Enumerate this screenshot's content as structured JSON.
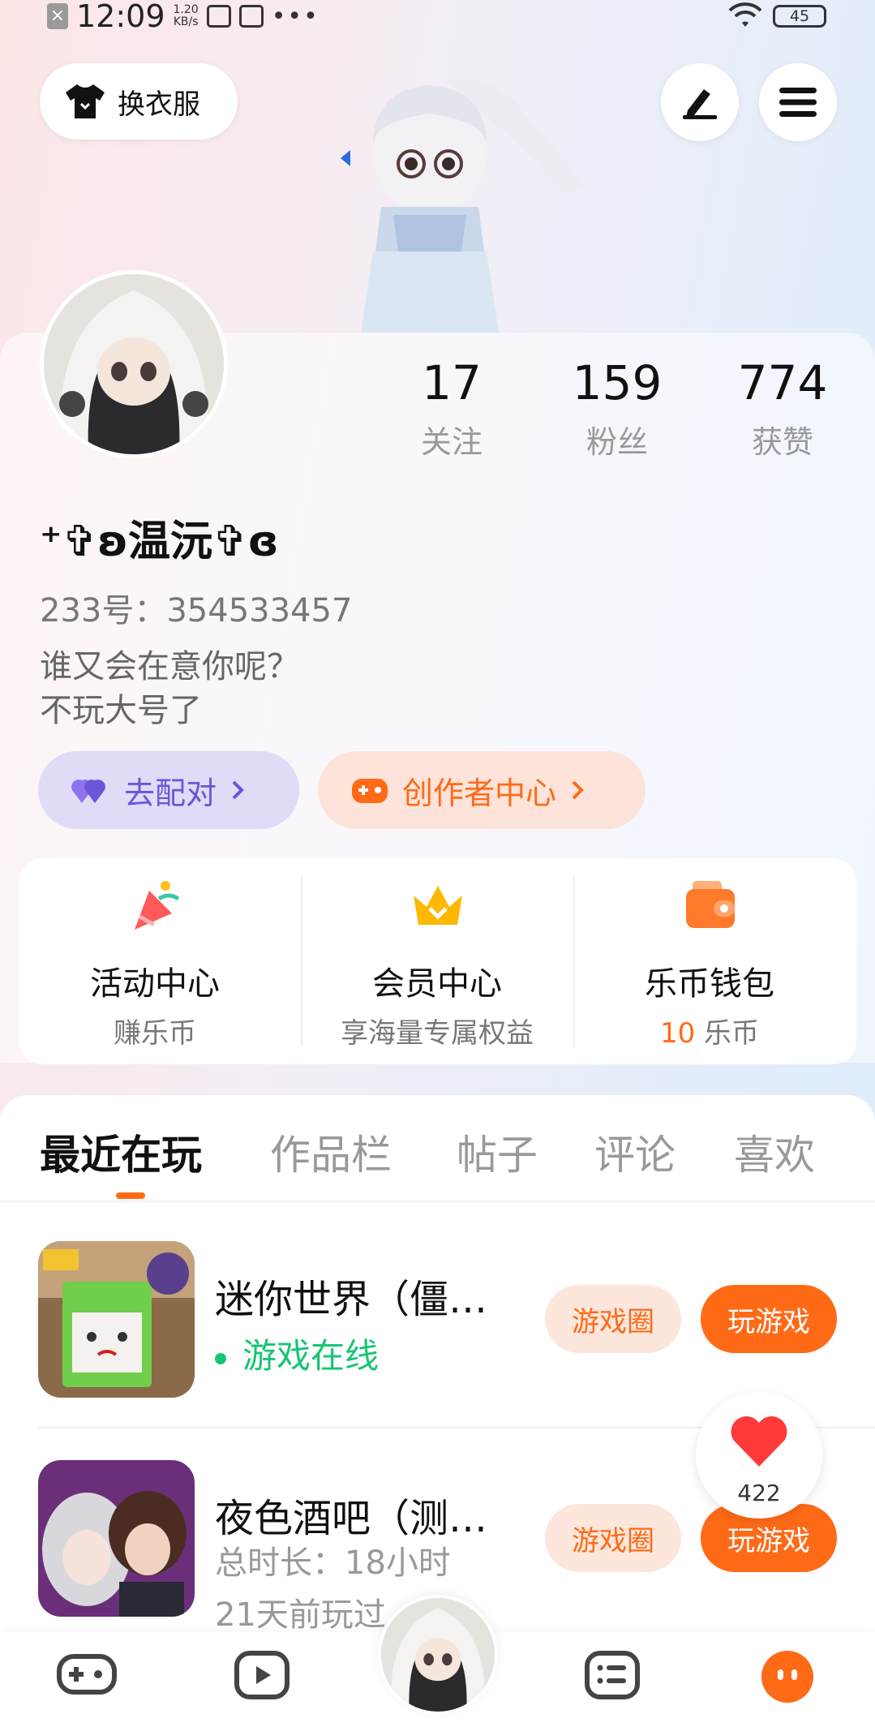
{
  "status_bar": {
    "time": "12:09",
    "speed_value": "1.20",
    "speed_unit": "KB/s",
    "dots": "•••",
    "battery": "45"
  },
  "header": {
    "outfit_label": "换衣服"
  },
  "profile": {
    "stats": [
      {
        "value": "17",
        "label": "关注"
      },
      {
        "value": "159",
        "label": "粉丝"
      },
      {
        "value": "774",
        "label": "获赞"
      }
    ],
    "username": "⁺✞ʚ温沅✞ɞ",
    "user_id": "233号：354533457",
    "bio_lines": [
      "谁又会在意你呢？",
      "不玩大号了"
    ],
    "match_label": "去配对",
    "creator_label": "创作者中心"
  },
  "quick_cards": [
    {
      "title": "活动中心",
      "subtitle": "赚乐币"
    },
    {
      "title": "会员中心",
      "subtitle": "享海量专属权益"
    },
    {
      "title": "乐币钱包",
      "subtitle_value": "10",
      "subtitle_unit": "乐币"
    }
  ],
  "tabs": [
    "最近在玩",
    "作品栏",
    "帖子",
    "评论",
    "喜欢"
  ],
  "games": [
    {
      "name": "迷你世界（僵…",
      "status": "游戏在线",
      "circle_label": "游戏圈",
      "play_label": "玩游戏"
    },
    {
      "name": "夜色酒吧（测…",
      "meta_lines": [
        "总时长：18小时",
        "21天前玩过"
      ],
      "circle_label": "游戏圈",
      "play_label": "玩游戏"
    }
  ],
  "like_count": "422",
  "colors": {
    "accent": "#ff6a17",
    "match_purple": "#6b55d8",
    "online_green": "#18c475"
  }
}
